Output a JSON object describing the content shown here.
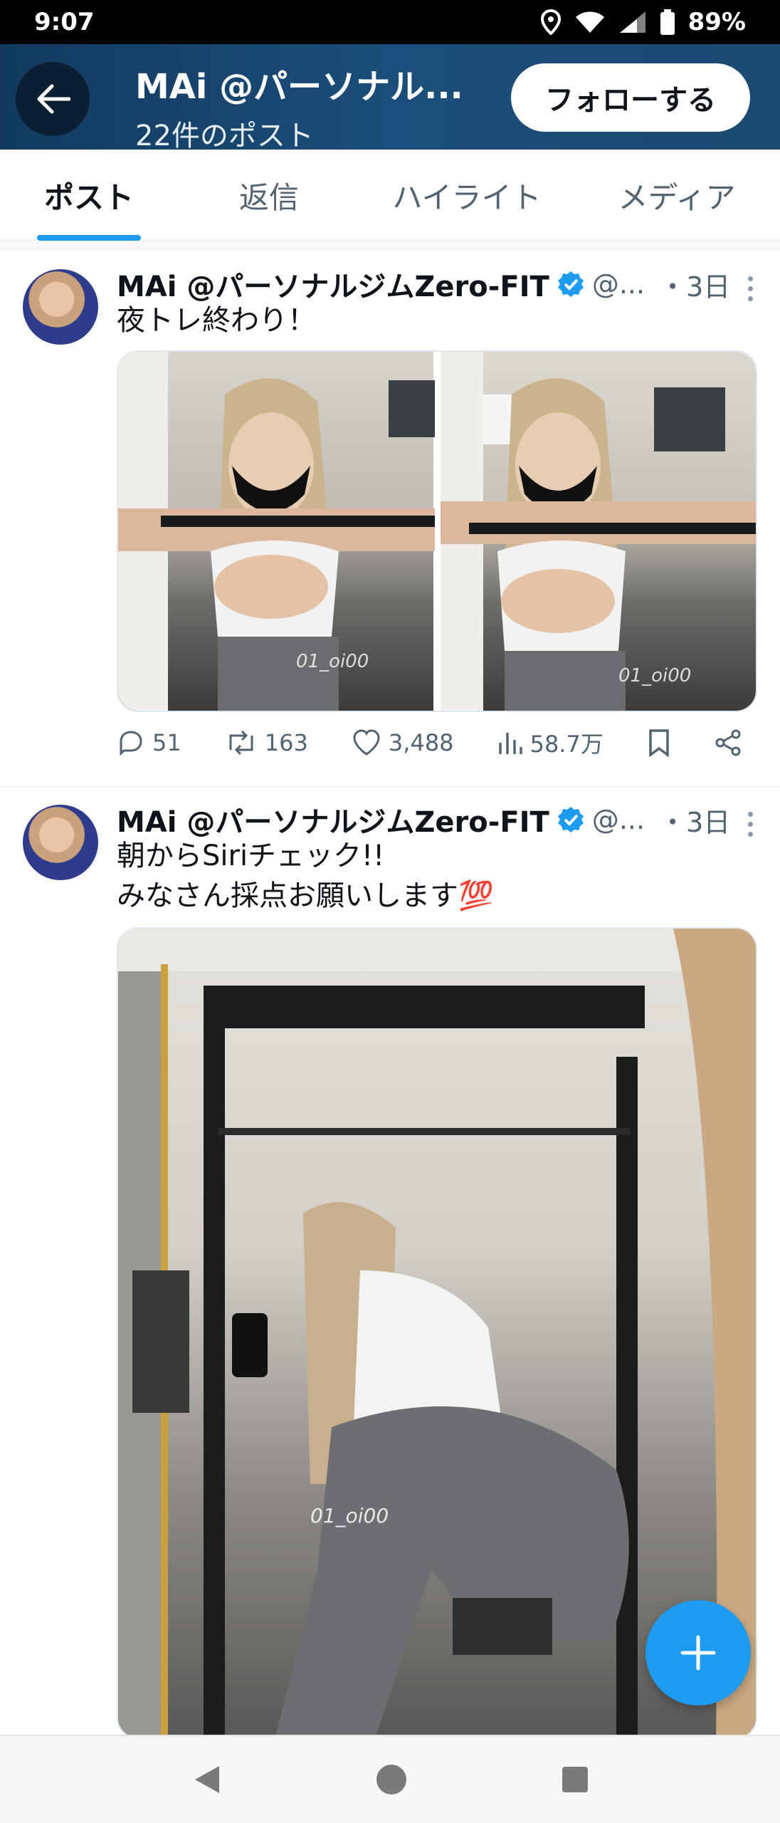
{
  "status": {
    "time": "9:07",
    "battery": "89%"
  },
  "header": {
    "title": "MAi @パーソナル...",
    "subtitle": "22件のポスト",
    "follow_label": "フォローする"
  },
  "tabs": [
    {
      "label": "ポスト",
      "active": true
    },
    {
      "label": "返信",
      "active": false
    },
    {
      "label": "ハイライト",
      "active": false
    },
    {
      "label": "メディア",
      "active": false
    }
  ],
  "posts": [
    {
      "name": "MAi @パーソナルジムZero-FIT",
      "handle": "@...",
      "time": "・3日",
      "text": "夜トレ終わり！",
      "watermark": "01_oi00",
      "replies": "51",
      "reposts": "163",
      "likes": "3,488",
      "views": "58.7万"
    },
    {
      "name": "MAi @パーソナルジムZero-FIT",
      "handle": "@...",
      "time": "・3日",
      "text_line1": "朝からSiriチェック!!",
      "text_line2": "みなさん採点お願いします",
      "emoji": "💯",
      "watermark": "01_oi00"
    }
  ],
  "colors": {
    "accent": "#1d9bf0",
    "header": "#1b4a72"
  }
}
